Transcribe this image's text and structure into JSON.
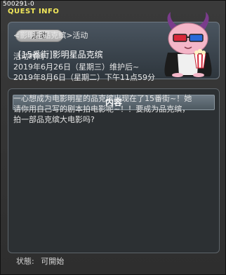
{
  "window": {
    "id_label": "500291-0",
    "title": "QUEST INFO"
  },
  "quest": {
    "category_tag": "活动",
    "name": "[15番街]影明星品克缤"
  },
  "content": {
    "header": "内容",
    "lines": [
      "<影明星品克缤>活动",
      "",
      "活动时间",
      "2019年6月26日（星期三）维护后~",
      "2019年8月6日（星期二）下午11点59分",
      "",
      "一心想成为电影明星的品克缤出现在了15番街~！她",
      "请你用自己写的剧本拍电影呢~！！要成为品克缤，",
      "拍一部品克缤大电影吗?"
    ]
  },
  "status": {
    "label": "状態:",
    "value": "可開始"
  },
  "icons": {
    "mascot": "pink-bean-3d-glasses-popcorn"
  },
  "colors": {
    "title": "#f2e85a",
    "panel_bg": "#2c3033",
    "header_bg": "#5e6b74"
  }
}
